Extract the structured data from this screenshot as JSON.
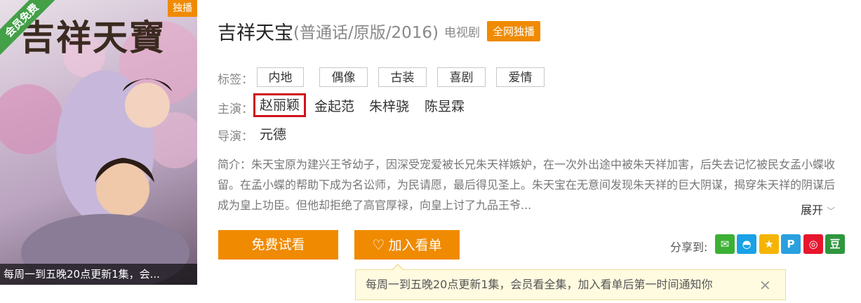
{
  "poster": {
    "title_art": "吉祥天寶",
    "ribbon": "会员免费",
    "exclusive_badge": "独播",
    "caption": "每周一到五晚20点更新1集，会..."
  },
  "header": {
    "title": "吉祥天宝",
    "subtitle": "(普通话/原版/2016)",
    "type": "电视剧",
    "badge": "全网独播"
  },
  "tags": {
    "label": "标签：",
    "items": [
      "内地",
      "偶像",
      "古装",
      "喜剧",
      "爱情"
    ]
  },
  "cast": {
    "label": "主演：",
    "actors": [
      "赵丽颖",
      "金起范",
      "朱梓骁",
      "陈昱霖"
    ]
  },
  "director": {
    "label": "导演：",
    "name": "元德"
  },
  "description": {
    "text": "简介：朱天宝原为建兴王爷幼子，因深受宠爱被长兄朱天祥嫉妒，在一次外出途中被朱天祥加害，后失去记忆被民女孟小蝶收留。在孟小蝶的帮助下成为名讼师，为民请愿，最后得见圣上。朱天宝在无意间发现朱天祥的巨大阴谋，揭穿朱天祥的阴谋后成为皇上功臣。但他却拒绝了高官厚禄，向皇上讨了九品王爷...",
    "expand_label": "展开"
  },
  "actions": {
    "watch_label": "免费试看",
    "add_label": "加入看单"
  },
  "share": {
    "label": "分享到:",
    "icons": [
      {
        "name": "wechat-icon",
        "glyph": "✉",
        "color": "#3cb035"
      },
      {
        "name": "qq-icon",
        "glyph": "◓",
        "color": "#1aa1e6"
      },
      {
        "name": "qzone-icon",
        "glyph": "★",
        "color": "#f5b400"
      },
      {
        "name": "tencent-weibo-icon",
        "glyph": "P",
        "color": "#2aa0e0"
      },
      {
        "name": "sina-weibo-icon",
        "glyph": "◎",
        "color": "#e6162d"
      },
      {
        "name": "douban-icon",
        "glyph": "豆",
        "color": "#2e963d"
      }
    ]
  },
  "notice": {
    "text": "每周一到五晚20点更新1集，会员看全集，加入看单后第一时间通知你",
    "close": "✕"
  }
}
